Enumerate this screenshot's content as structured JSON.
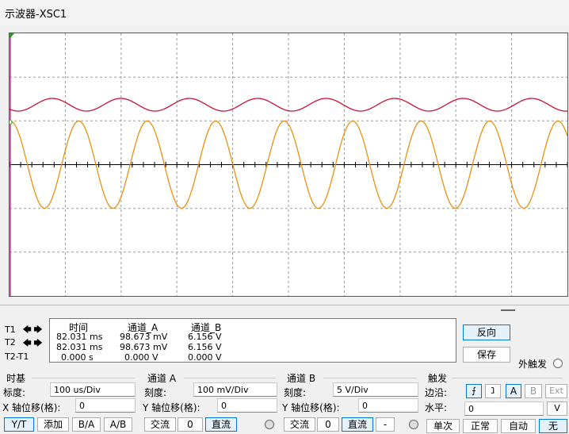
{
  "window": {
    "title": "示波器-XSC1"
  },
  "readout": {
    "headers": [
      "时间",
      "通道_A",
      "通道_B"
    ],
    "rows": [
      {
        "label": "T1",
        "time": "82.031 ms",
        "a": "98.673 mV",
        "b": "6.156 V"
      },
      {
        "label": "T2",
        "time": "82.031 ms",
        "a": "98.673 mV",
        "b": "6.156 V"
      },
      {
        "label": "T2-T1",
        "time": "0.000 s",
        "a": "0.000 V",
        "b": "0.000 V"
      }
    ]
  },
  "side_buttons": {
    "reverse": "反向",
    "save": "保存",
    "ext_trigger": "外触发"
  },
  "timebase": {
    "title": "时基",
    "scale_label": "标度:",
    "scale": "100 us/Div",
    "xpos_label": "X 轴位移(格):",
    "xpos": "0",
    "modes": [
      "Y/T",
      "添加",
      "B/A",
      "A/B"
    ]
  },
  "channel_a": {
    "title": "通道 A",
    "scale_label": "刻度:",
    "scale": "100 mV/Div",
    "ypos_label": "Y 轴位移(格):",
    "ypos": "0",
    "coupling": [
      "交流",
      "0",
      "直流"
    ]
  },
  "channel_b": {
    "title": "通道 B",
    "scale_label": "刻度:",
    "scale": "5  V/Div",
    "ypos_label": "Y 轴位移(格):",
    "ypos": "0",
    "coupling": [
      "交流",
      "0",
      "直流",
      "-"
    ]
  },
  "trigger": {
    "title": "触发",
    "edge_label": "边沿:",
    "edge_buttons": [
      "A",
      "B",
      "Ext"
    ],
    "level_label": "水平:",
    "level": "0",
    "level_unit": "V",
    "modes": [
      "单次",
      "正常",
      "自动",
      "无"
    ]
  },
  "colors": {
    "channel_a": "#cc1133",
    "channel_b": "#e88a00",
    "active_border": "#0078d7"
  }
}
